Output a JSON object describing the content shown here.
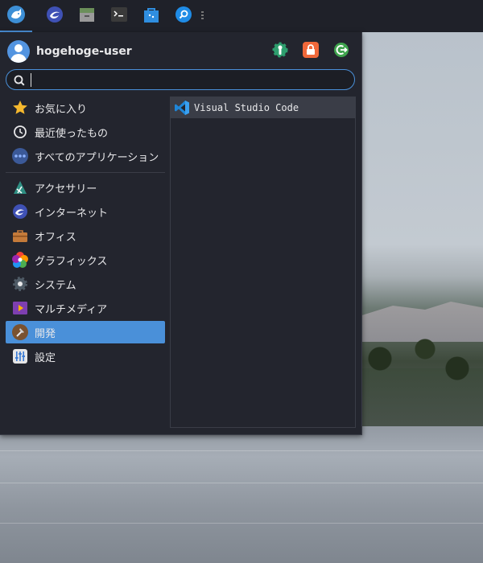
{
  "taskbar": {
    "items": [
      {
        "name": "whisker-menu-button",
        "icon": "xfce-mouse-logo-icon"
      },
      {
        "name": "web-browser-launcher",
        "icon": "browser-icon"
      },
      {
        "name": "file-manager-launcher",
        "icon": "file-cabinet-icon"
      },
      {
        "name": "terminal-launcher",
        "icon": "terminal-icon"
      },
      {
        "name": "software-store-launcher",
        "icon": "store-bag-icon"
      },
      {
        "name": "app-finder-launcher",
        "icon": "magnifier-icon"
      }
    ]
  },
  "menu": {
    "username": "hogehoge-user",
    "actions": [
      {
        "name": "settings-manager-button",
        "icon": "settings-gear-icon",
        "color": "#2e9e6e"
      },
      {
        "name": "lock-screen-button",
        "icon": "lock-icon",
        "color": "#f0683a"
      },
      {
        "name": "logout-button",
        "icon": "logout-icon",
        "color": "#3fa34d"
      }
    ],
    "search": {
      "value": "",
      "placeholder": ""
    },
    "categories_top": [
      {
        "label": "お気に入り",
        "icon": "star-icon"
      },
      {
        "label": "最近使ったもの",
        "icon": "clock-icon"
      },
      {
        "label": "すべてのアプリケーション",
        "icon": "dots-icon"
      }
    ],
    "categories": [
      {
        "label": "アクセサリー",
        "icon": "accessories-icon"
      },
      {
        "label": "インターネット",
        "icon": "internet-icon"
      },
      {
        "label": "オフィス",
        "icon": "briefcase-icon"
      },
      {
        "label": "グラフィックス",
        "icon": "graphics-icon"
      },
      {
        "label": "システム",
        "icon": "system-gear-icon"
      },
      {
        "label": "マルチメディア",
        "icon": "multimedia-icon"
      },
      {
        "label": "開発",
        "icon": "hammer-icon",
        "selected": true
      },
      {
        "label": "設定",
        "icon": "settings-sliders-icon"
      }
    ],
    "apps": [
      {
        "label": "Visual Studio Code",
        "icon": "vscode-icon"
      }
    ]
  },
  "colors": {
    "accent": "#4a90d9",
    "menu_bg": "#23252e",
    "taskbar_bg": "#1f2129"
  }
}
